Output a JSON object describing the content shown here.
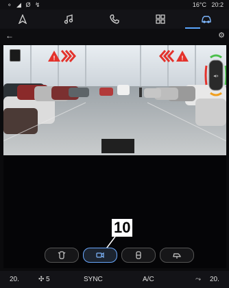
{
  "status": {
    "left_icons": "⚬ ◢ Ø ↯",
    "temperature": "16°C",
    "time": "20:2"
  },
  "tabs": [
    {
      "name": "navigation",
      "icon": "nav-arrow-icon"
    },
    {
      "name": "music",
      "icon": "music-note-icon"
    },
    {
      "name": "phone",
      "icon": "phone-icon"
    },
    {
      "name": "apps",
      "icon": "apps-grid-icon"
    },
    {
      "name": "vehicle",
      "icon": "car-icon",
      "active": true
    }
  ],
  "subheader": {
    "back": "←",
    "settings": "⚙"
  },
  "callout": {
    "label": "10"
  },
  "viewmodes": [
    {
      "name": "rear-camera",
      "icon": "rear-camera-icon"
    },
    {
      "name": "front-camera",
      "icon": "front-camera-icon",
      "selected": true
    },
    {
      "name": "top-view",
      "icon": "top-view-icon"
    },
    {
      "name": "side-view",
      "icon": "side-view-icon"
    }
  ],
  "climate": {
    "left_temp": "20.",
    "fan_level": "5",
    "sync": "SYNC",
    "ac": "A/C",
    "right_temp": "20."
  },
  "colors": {
    "accent": "#5aa6ff",
    "warning": "#e4322b"
  }
}
